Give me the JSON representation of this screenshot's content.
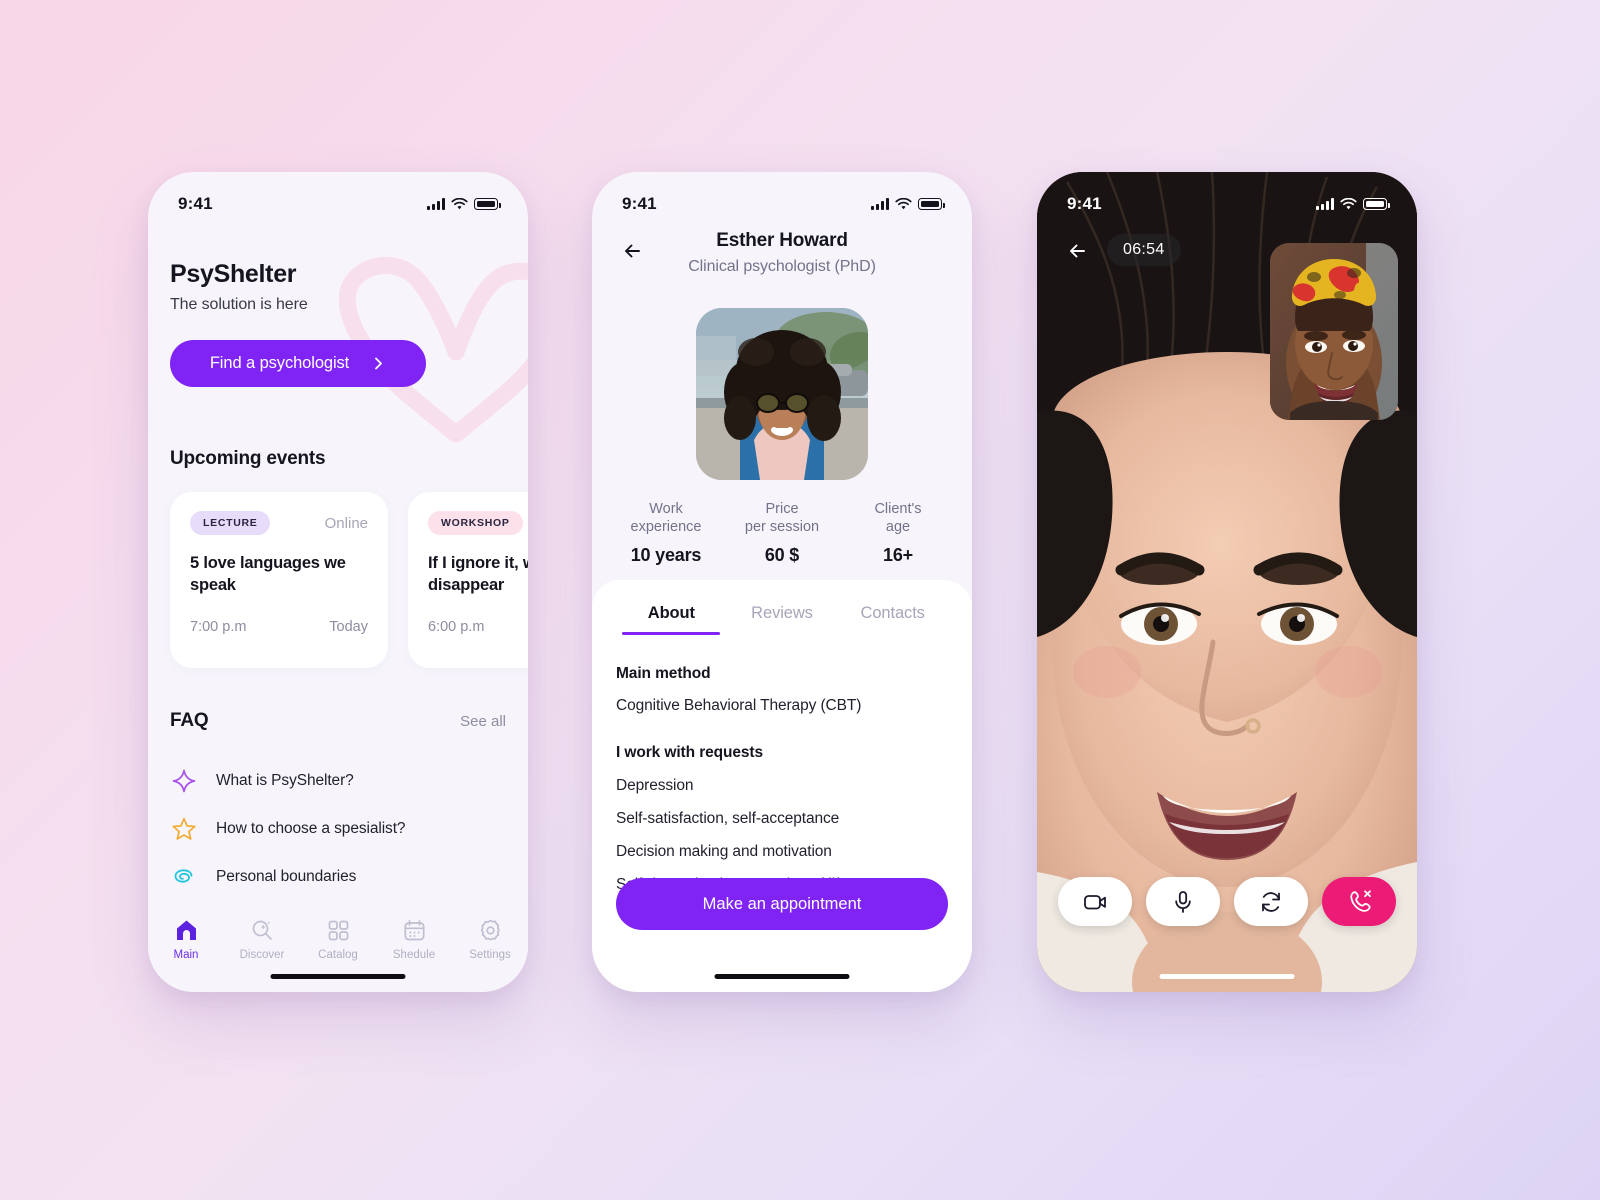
{
  "theme": {
    "purple": "#8024f5",
    "purple_nav": "#6d2fe8",
    "pink_end_call": "#ec1b75",
    "screen_bg": "#f7f5fb",
    "heart_pink": "#f8e0ec",
    "bg_gradient_from": "#f8d7e6",
    "bg_gradient_to": "#ddd4f5"
  },
  "phone1": {
    "status": {
      "time": "9:41",
      "signal_icon": "cellular-bars-icon",
      "wifi_icon": "wifi-icon",
      "battery_icon": "battery-full-icon"
    },
    "brand": "PsyShelter",
    "tagline": "The solution is here",
    "cta": {
      "label": "Find a psychologist",
      "icon": "chevron-right-icon"
    },
    "events_title": "Upcoming events",
    "events": [
      {
        "tag": "LECTURE",
        "tag_style": "lecture",
        "mode": "Online",
        "title": "5 love languages we speak",
        "time": "7:00 p.m",
        "day": "Today"
      },
      {
        "tag": "WORKSHOP",
        "tag_style": "workshop",
        "mode": "",
        "title": "If I ignore it, will disappear",
        "time": "6:00 p.m",
        "day": ""
      }
    ],
    "faq_title": "FAQ",
    "see_all": "See all",
    "faq_items": [
      {
        "icon": "sparkle-icon",
        "label": "What is PsyShelter?"
      },
      {
        "icon": "star-outline-icon",
        "label": "How to choose a spesialist?"
      },
      {
        "icon": "spiral-icon",
        "label": "Personal boundaries"
      }
    ],
    "tabs": [
      {
        "icon": "home-icon",
        "label": "Main",
        "active": true
      },
      {
        "icon": "discover-search-icon",
        "label": "Discover",
        "active": false
      },
      {
        "icon": "catalog-grid-icon",
        "label": "Catalog",
        "active": false
      },
      {
        "icon": "calendar-icon",
        "label": "Shedule",
        "active": false
      },
      {
        "icon": "gear-icon",
        "label": "Settings",
        "active": false
      }
    ]
  },
  "phone2": {
    "status": {
      "time": "9:41"
    },
    "back_icon": "arrow-left-icon",
    "name": "Esther Howard",
    "role": "Clinical psychologist (PhD)",
    "avatar_alt": "psychologist-portrait",
    "stats": [
      {
        "label_line1": "Work",
        "label_line2": "experience",
        "value": "10 years"
      },
      {
        "label_line1": "Price",
        "label_line2": "per session",
        "value": "60 $"
      },
      {
        "label_line1": "Client's",
        "label_line2": "age",
        "value": "16+"
      }
    ],
    "tabs": [
      {
        "label": "About",
        "active": true
      },
      {
        "label": "Reviews",
        "active": false
      },
      {
        "label": "Contacts",
        "active": false
      }
    ],
    "about": {
      "method_heading": "Main method",
      "method_value": "Cognitive Behavioral Therapy (CBT)",
      "requests_heading": "I work with requests",
      "requests": [
        "Depression",
        "Self-satisfaction, self-acceptance",
        "Decision making and motivation",
        "Self-determination, meaning of life"
      ]
    },
    "appointment_label": "Make an appointment"
  },
  "phone3": {
    "status": {
      "time": "9:41"
    },
    "back_icon": "arrow-left-icon",
    "timer": "06:54",
    "remote_video_alt": "remote-participant-video",
    "pip_alt": "self-view-video",
    "controls": [
      {
        "icon": "video-camera-icon",
        "name": "toggle-camera-button",
        "style": "light"
      },
      {
        "icon": "microphone-icon",
        "name": "toggle-microphone-button",
        "style": "light"
      },
      {
        "icon": "switch-camera-icon",
        "name": "switch-camera-button",
        "style": "light"
      },
      {
        "icon": "end-call-icon",
        "name": "end-call-button",
        "style": "end"
      }
    ]
  }
}
